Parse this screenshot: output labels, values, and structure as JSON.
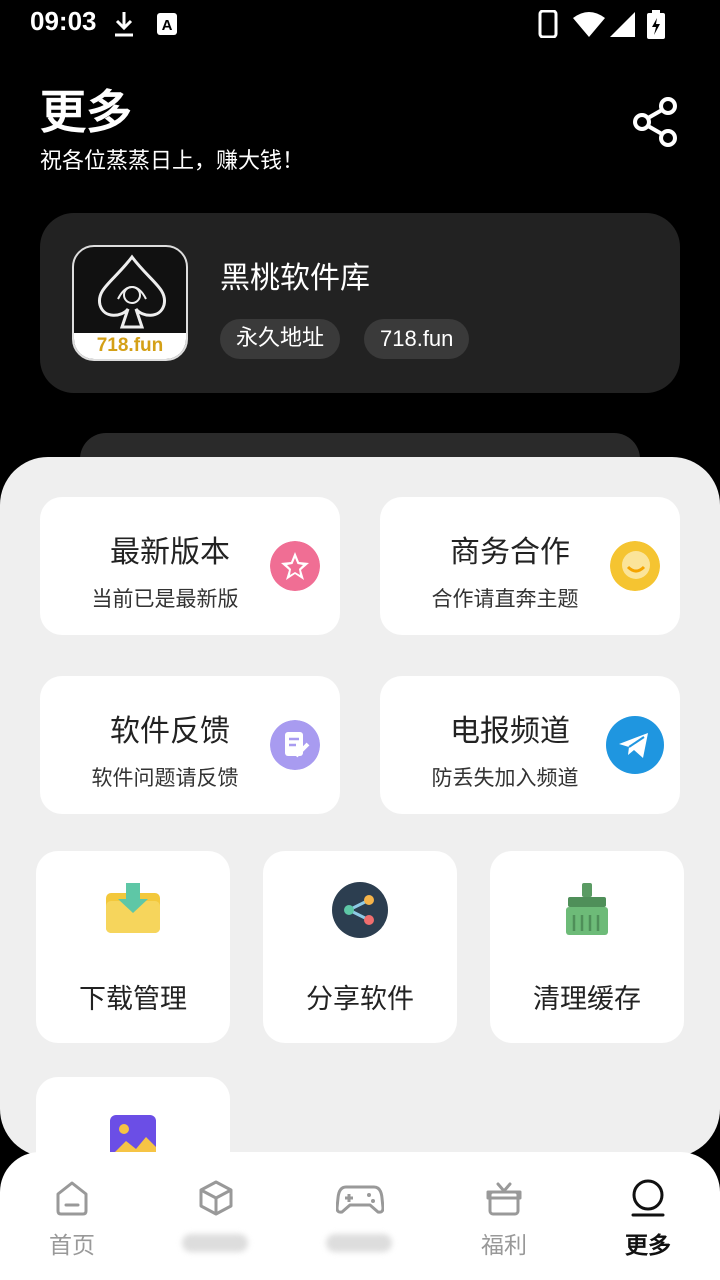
{
  "status_bar": {
    "time": "09:03",
    "icons": [
      "download-icon",
      "keyboard-a-icon",
      "phone-icon",
      "wifi-icon",
      "signal-icon",
      "battery-charging-icon"
    ]
  },
  "header": {
    "title": "更多",
    "subtitle": "祝各位蒸蒸日上，赚大钱！",
    "share_icon": "share-icon"
  },
  "app_card": {
    "logo_text": "718.fun",
    "name": "黑桃软件库",
    "tags": [
      "永久地址",
      "718.fun"
    ]
  },
  "feature_cards": [
    {
      "title": "最新版本",
      "subtitle": "当前已是最新版",
      "icon": "star-icon",
      "color": "#f06e94"
    },
    {
      "title": "商务合作",
      "subtitle": "合作请直奔主题",
      "icon": "chat-bubble-icon",
      "color": "#f5c431"
    },
    {
      "title": "软件反馈",
      "subtitle": "软件问题请反馈",
      "icon": "feedback-edit-icon",
      "color": "#a89bf0"
    },
    {
      "title": "电报频道",
      "subtitle": "防丢失加入频道",
      "icon": "telegram-icon",
      "color": "#1f96e0"
    }
  ],
  "tool_cards": [
    {
      "label": "下载管理",
      "icon": "download-folder-icon"
    },
    {
      "label": "分享软件",
      "icon": "share-circle-icon"
    },
    {
      "label": "清理缓存",
      "icon": "broom-icon"
    },
    {
      "label": "",
      "icon": "image-gallery-icon"
    }
  ],
  "tabbar": {
    "tabs": [
      {
        "label": "首页",
        "icon": "home-icon"
      },
      {
        "label": "",
        "icon": "cube-icon"
      },
      {
        "label": "",
        "icon": "gamepad-icon"
      },
      {
        "label": "福利",
        "icon": "gift-icon"
      },
      {
        "label": "更多",
        "icon": "user-icon"
      }
    ],
    "active_index": 4
  }
}
